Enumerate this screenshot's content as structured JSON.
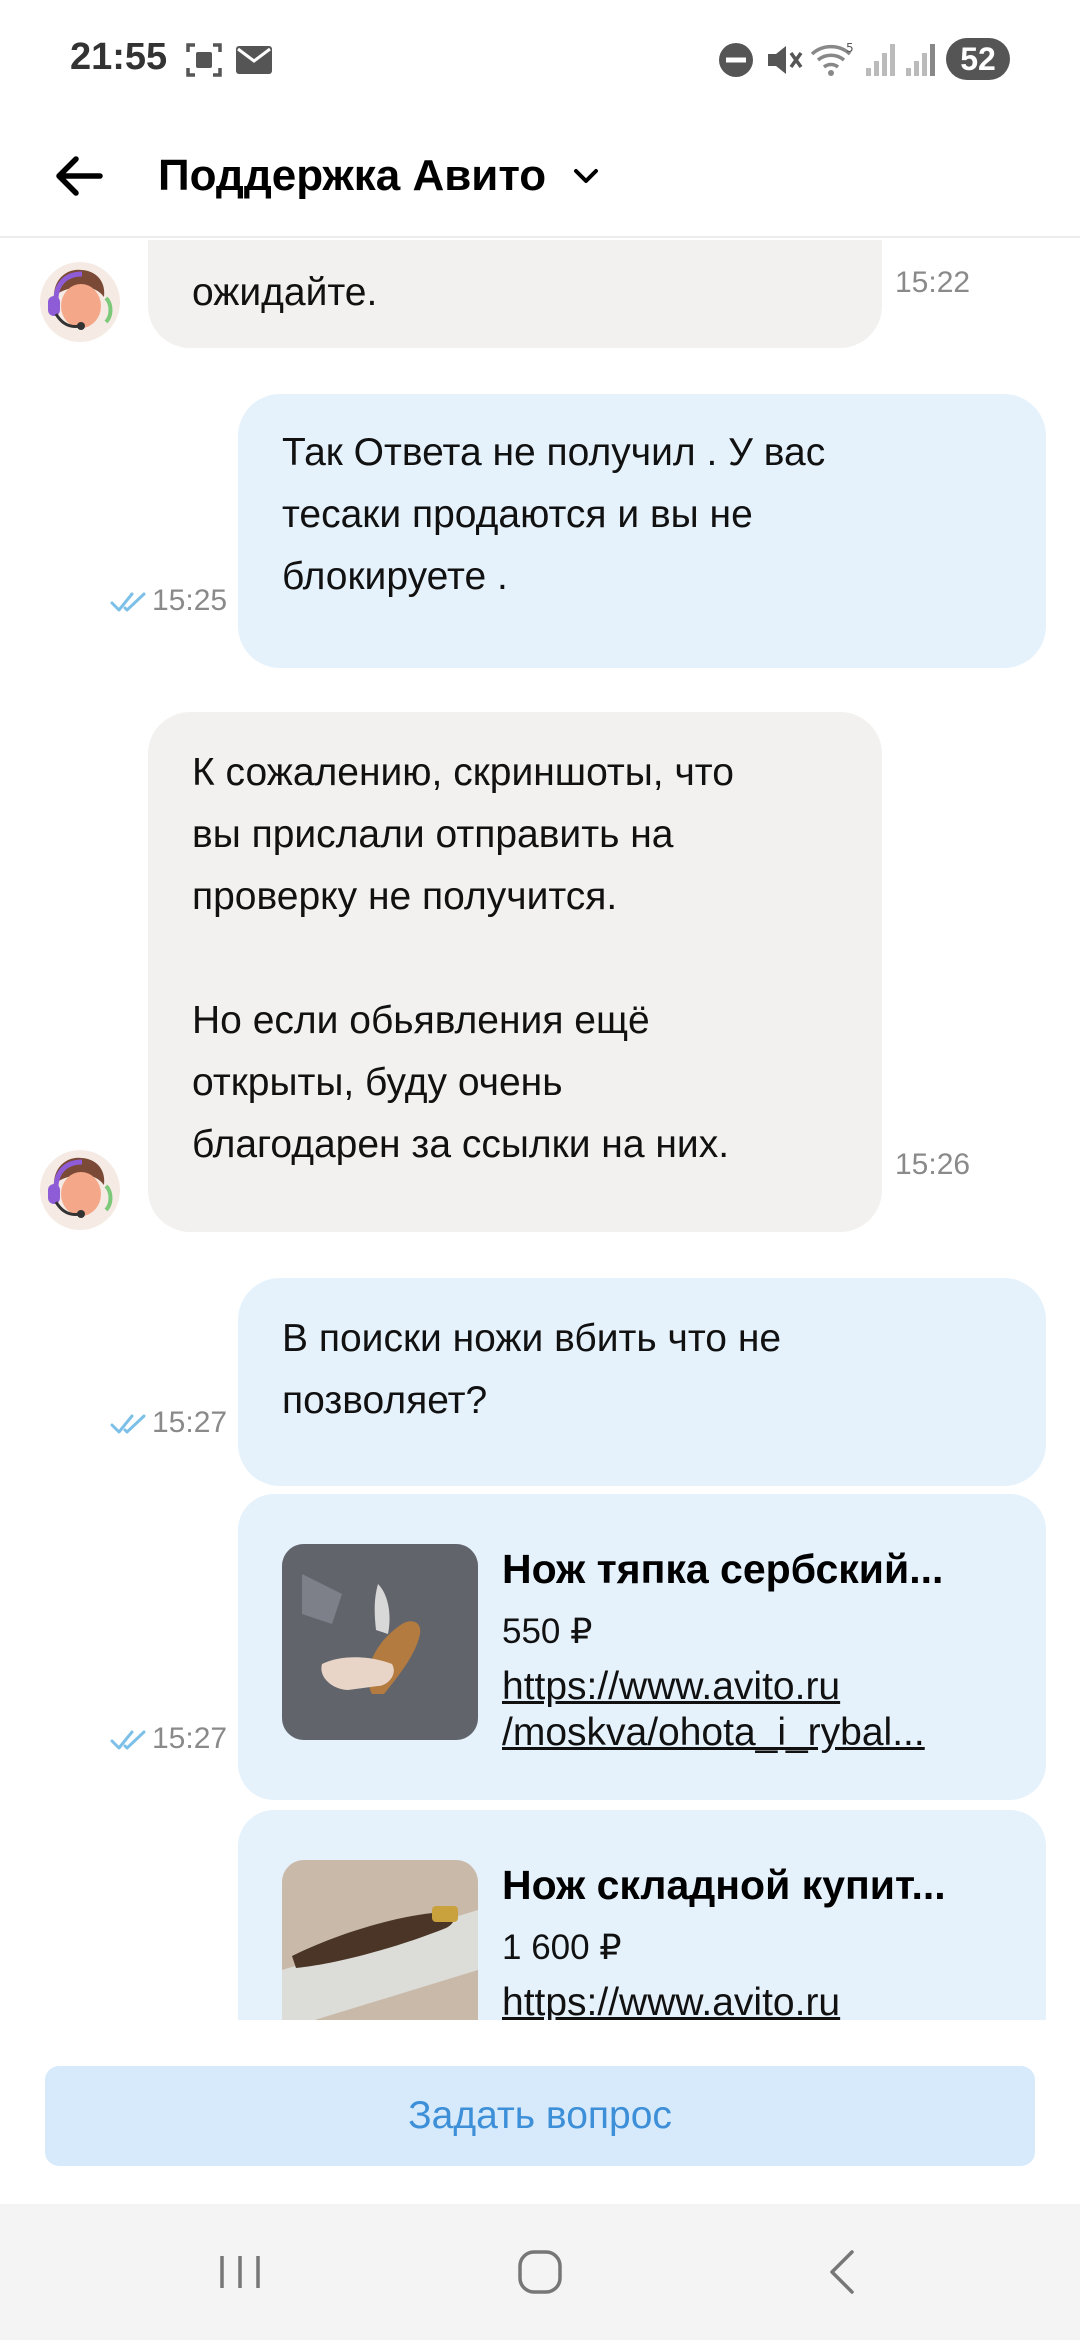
{
  "status_bar": {
    "time": "21:55",
    "battery": "52",
    "icons": [
      "screenshot-icon",
      "mail-icon",
      "dnd-icon",
      "mute-icon",
      "wifi-icon",
      "signal-icon",
      "signal-icon-2"
    ]
  },
  "header": {
    "title": "Поддержка Авито"
  },
  "messages": [
    {
      "direction": "in",
      "text": "ожидайте.",
      "time": "15:22"
    },
    {
      "direction": "out",
      "text": "Так Ответа  не получил . У вас\nтесаки продаются и вы не\nблокируете .",
      "time": "15:25"
    },
    {
      "direction": "in",
      "text": "К сожалению, скриншоты, что\nвы прислали отправить на\nпроверку не получится.\n\nНо если обьявления ещё\nоткрыты, буду очень\nблагодарен за ссылки на них.",
      "time": "15:26"
    },
    {
      "direction": "out",
      "text": "В поиски ножи вбить что не\nпозволяет?",
      "time": "15:27"
    }
  ],
  "cards": [
    {
      "title": "Нож тяпка сербский...",
      "price": "550 ₽",
      "link_line1": "https://www.avito.ru",
      "link_line2": "/moskva/ohota_i_rybal...",
      "time": "15:27"
    },
    {
      "title": "Нож складной купит...",
      "price": "1 600 ₽",
      "link_line1": "https://www.avito.ru",
      "link_line2": ""
    }
  ],
  "bottom": {
    "ask_label": "Задать вопрос"
  },
  "colors": {
    "incoming_bubble": "#f2f1ef",
    "outgoing_bubble": "#e5f2fc",
    "button_bg": "#d6eafb",
    "button_text": "#3d8fd8",
    "read_check": "#7cc0e8"
  }
}
